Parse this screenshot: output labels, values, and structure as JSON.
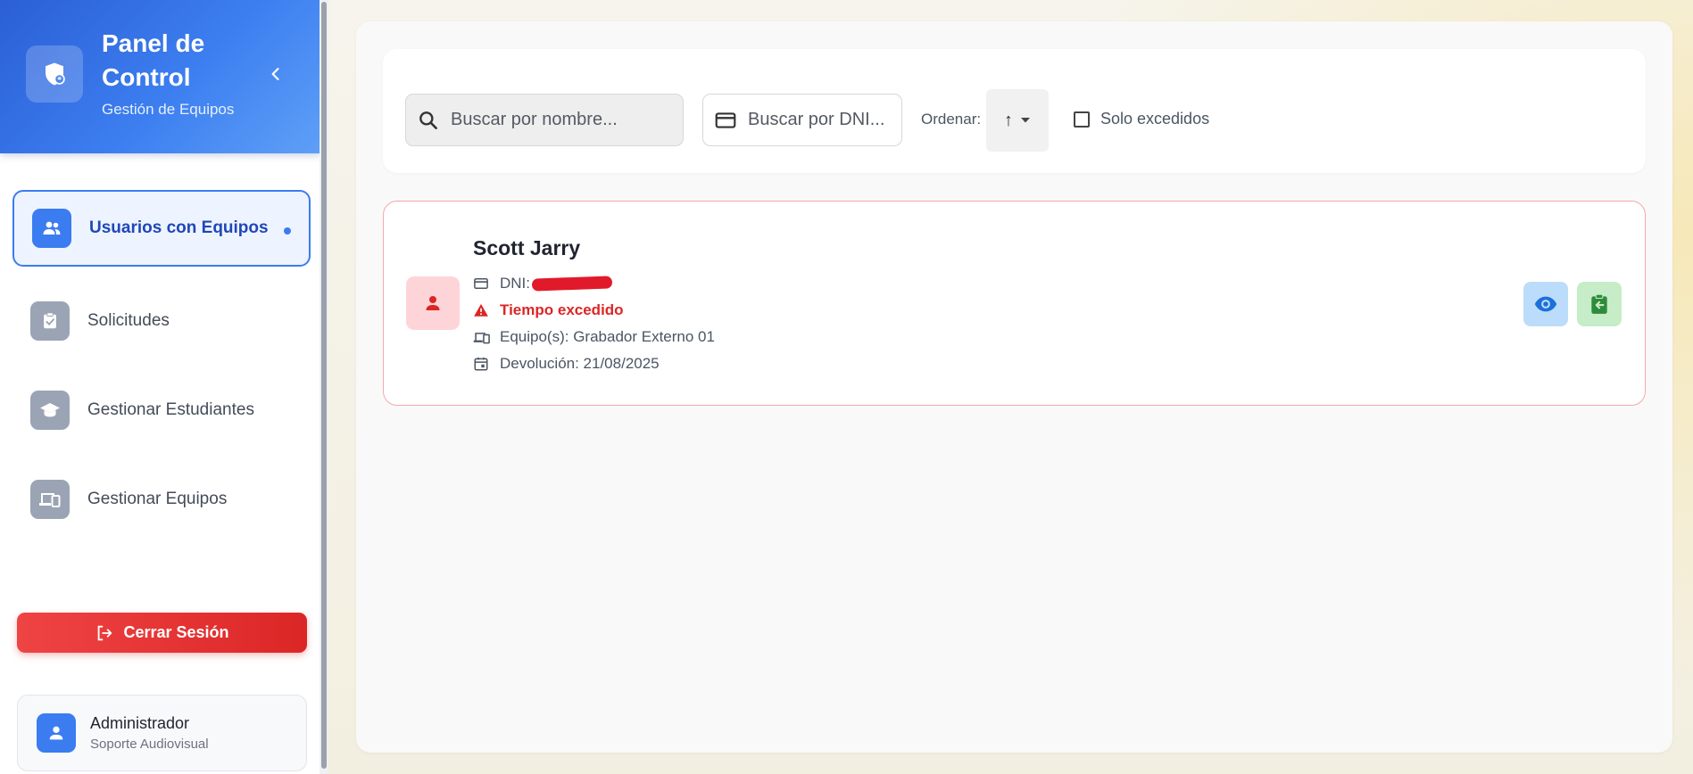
{
  "sidebar": {
    "title": "Panel de Control",
    "subtitle": "Gestión de Equipos",
    "items": [
      {
        "label": "Usuarios con Equipos",
        "active": true,
        "icon": "users-icon"
      },
      {
        "label": "Solicitudes",
        "active": false,
        "icon": "clipboard-check-icon"
      },
      {
        "label": "Gestionar Estudiantes",
        "active": false,
        "icon": "graduation-cap-icon"
      },
      {
        "label": "Gestionar Equipos",
        "active": false,
        "icon": "devices-icon"
      }
    ],
    "logout_label": "Cerrar Sesión",
    "user": {
      "name": "Administrador",
      "role": "Soporte Audiovisual"
    }
  },
  "filters": {
    "search_name_placeholder": "Buscar por nombre...",
    "search_dni_placeholder": "Buscar por DNI...",
    "sort_label": "Ordenar:",
    "sort_value": "↑",
    "only_exceeded_label": "Solo excedidos",
    "only_exceeded_checked": false
  },
  "loans": [
    {
      "name": "Scott Jarry",
      "dni_label": "DNI:",
      "status": "Tiempo excedido",
      "equipment": "Equipo(s): Grabador Externo 01",
      "return_date": "Devolución: 21/08/2025"
    }
  ],
  "colors": {
    "primary": "#3b7cf0",
    "danger": "#dc2626",
    "success": "#2e8b3a"
  }
}
